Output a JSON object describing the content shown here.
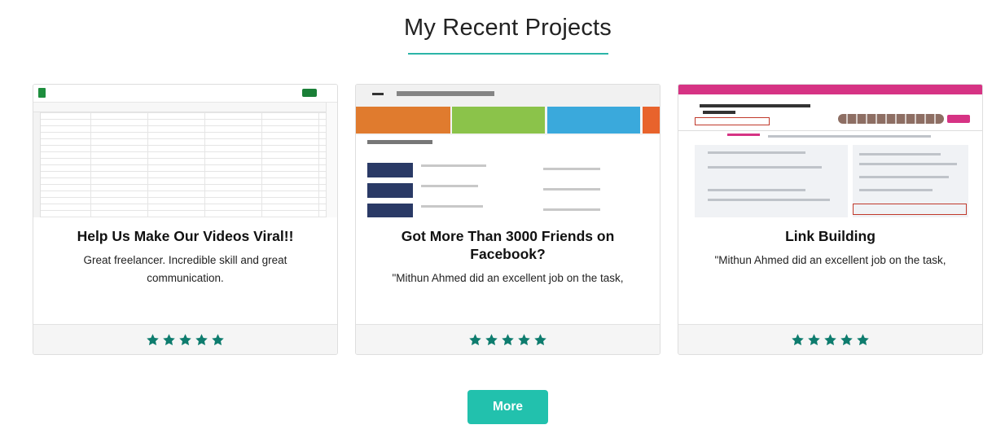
{
  "section": {
    "title": "My Recent Projects"
  },
  "projects": [
    {
      "title": "Help Us Make Our Videos Viral!!",
      "text": "Great freelancer. Incredible skill and great communication.",
      "rating": 5,
      "rating_max": 5,
      "thumbnail": "spreadsheet-screenshot"
    },
    {
      "title": "Got More Than 3000 Friends on Facebook?",
      "text": "\"Mithun Ahmed did an excellent job on the task,",
      "rating": 5,
      "rating_max": 5,
      "thumbnail": "page-insights-screenshot"
    },
    {
      "title": "Link Building",
      "text": "\"Mithun Ahmed did an excellent job on the task,",
      "rating": 5,
      "rating_max": 5,
      "thumbnail": "facebook-group-screenshot"
    }
  ],
  "more_button": {
    "label": "More"
  },
  "colors": {
    "accent": "#2bb5a8",
    "button": "#22c1ad",
    "star": "#0e7c6e"
  },
  "icons": {
    "star": "star-icon"
  }
}
